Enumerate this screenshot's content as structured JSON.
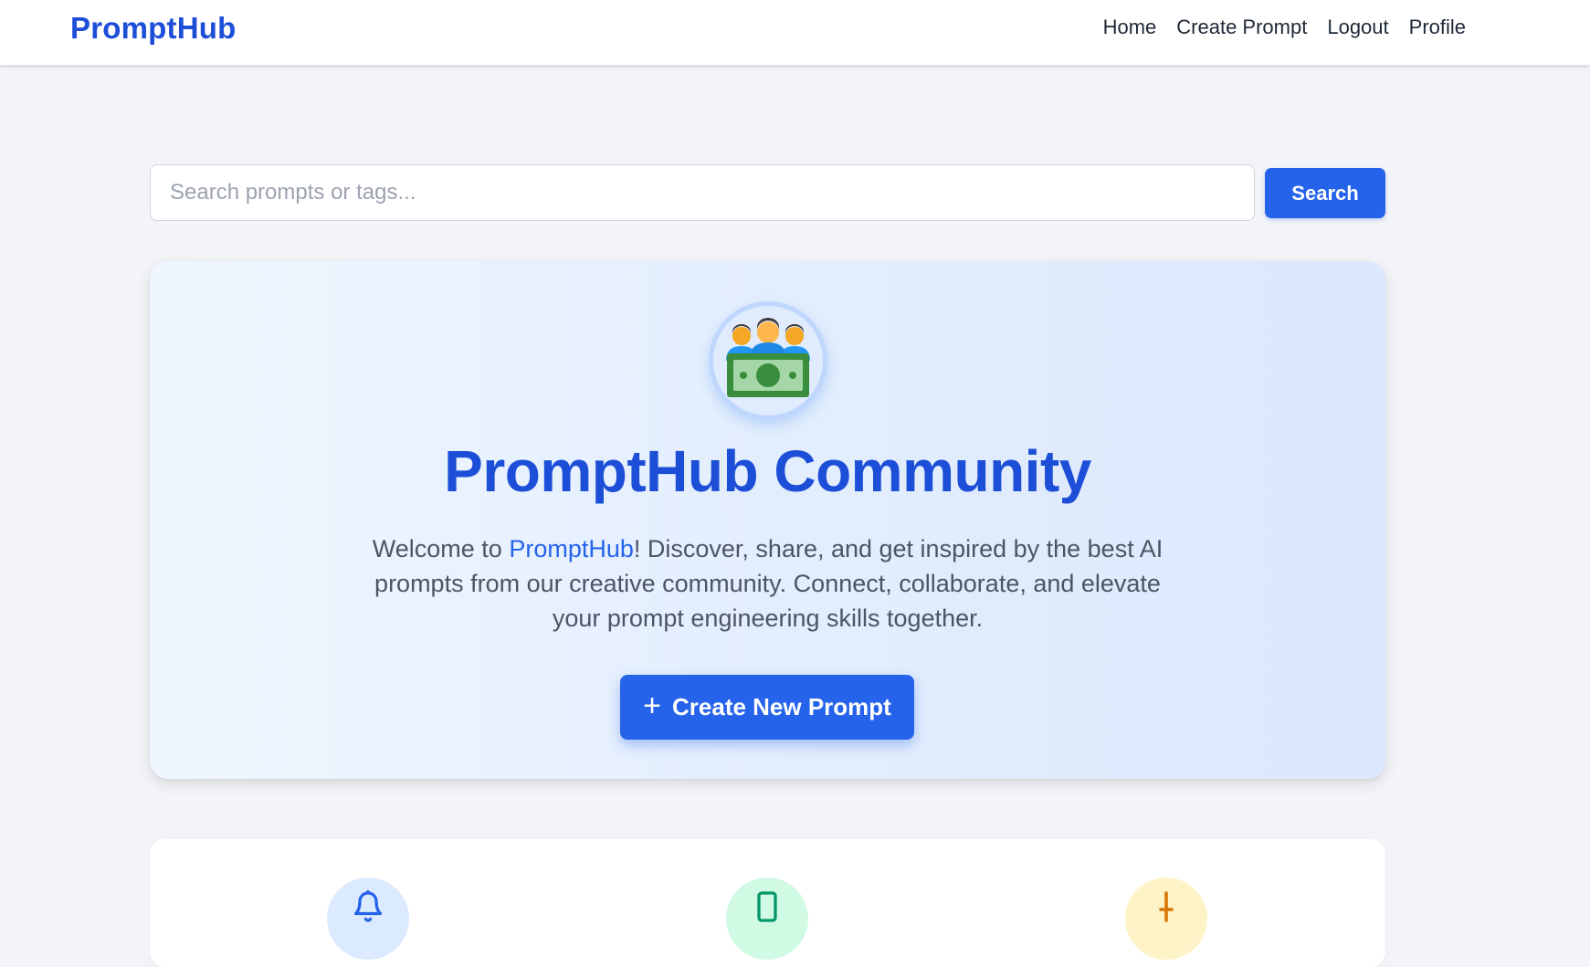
{
  "nav": {
    "brand": "PromptHub",
    "links": [
      "Home",
      "Create Prompt",
      "Logout",
      "Profile"
    ]
  },
  "search": {
    "placeholder": "Search prompts or tags...",
    "button_label": "Search"
  },
  "hero": {
    "icon": "community-money-icon",
    "title": "PromptHub Community",
    "desc_prefix": "Welcome to ",
    "desc_brand": "PromptHub",
    "desc_suffix": "! Discover, share, and get inspired by the best AI prompts from our creative community. Connect, collaborate, and elevate your prompt engineering skills together.",
    "cta_icon": "+",
    "cta_label": "Create New Prompt"
  },
  "features": {
    "icons": [
      "bell-icon",
      "phone-icon",
      "pen-icon"
    ]
  },
  "colors": {
    "accent": "#2563eb",
    "brand": "#1d4ed8",
    "page_bg": "#f2f4f7"
  }
}
